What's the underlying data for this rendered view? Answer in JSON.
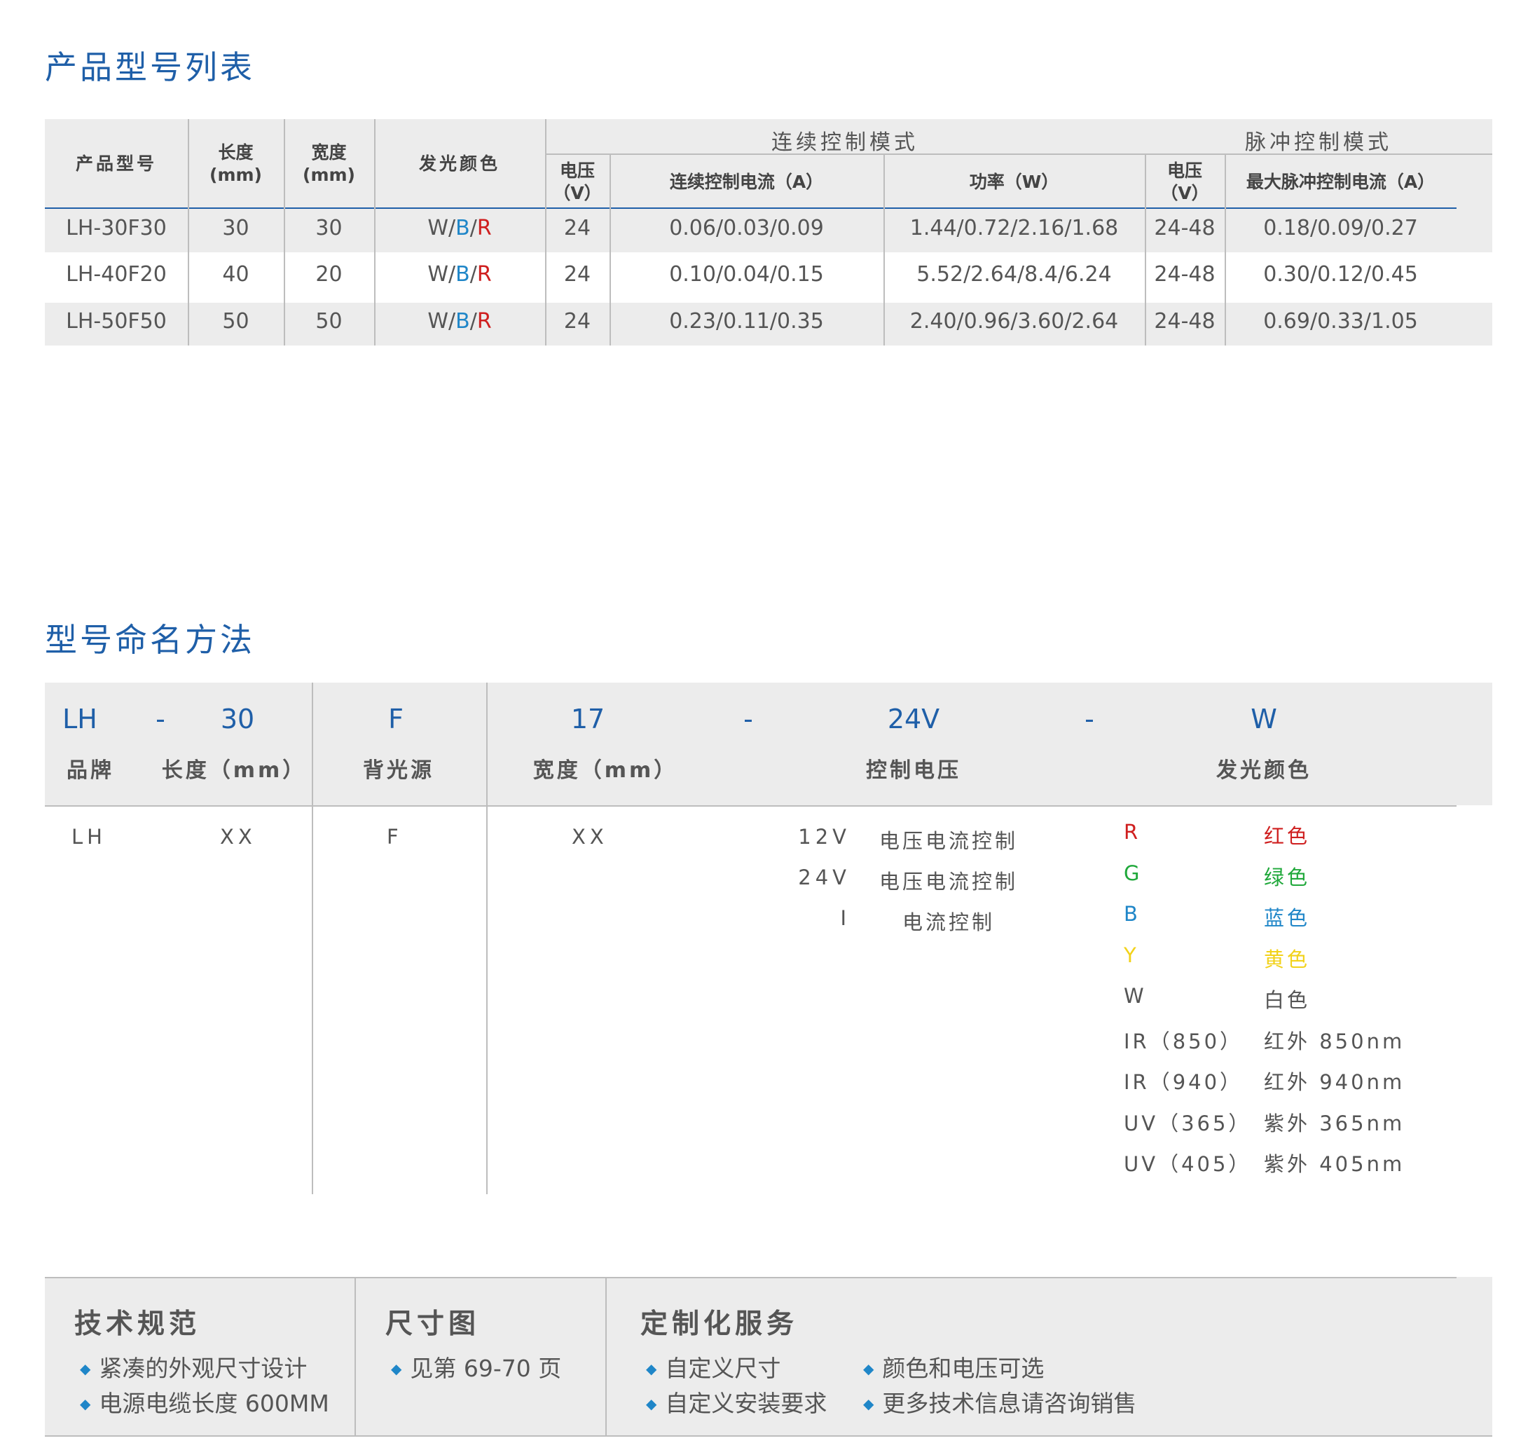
{
  "sections": {
    "model_list_title": "产品型号列表",
    "naming_title": "型号命名方法"
  },
  "table": {
    "headers": {
      "model": "产品型号",
      "length": "长度",
      "length_unit": "(mm)",
      "width": "宽度",
      "width_unit": "(mm)",
      "color": "发光颜色",
      "continuous_mode": "连续控制模式",
      "pulse_mode": "脉冲控制模式",
      "voltage": "电压",
      "voltage_unit": "（V）",
      "continuous_current": "连续控制电流（A）",
      "power": "功率（W）",
      "pulse_voltage": "电压",
      "pulse_voltage_unit": "（V）",
      "max_pulse_current": "最大脉冲控制电流（A）"
    },
    "rows": [
      {
        "model": "LH-30F30",
        "length": "30",
        "width": "30",
        "color_w": "W",
        "sep1": "/",
        "color_b": "B",
        "sep2": "/",
        "color_r": "R",
        "voltage": "24",
        "current": "0.06/0.03/0.09",
        "power": "1.44/0.72/2.16/1.68",
        "pulse_voltage": "24-48",
        "pulse_current": "0.18/0.09/0.27"
      },
      {
        "model": "LH-40F20",
        "length": "40",
        "width": "20",
        "color_w": "W",
        "sep1": "/",
        "color_b": "B",
        "sep2": "/",
        "color_r": "R",
        "voltage": "24",
        "current": "0.10/0.04/0.15",
        "power": "5.52/2.64/8.4/6.24",
        "pulse_voltage": "24-48",
        "pulse_current": "0.30/0.12/0.45"
      },
      {
        "model": "LH-50F50",
        "length": "50",
        "width": "50",
        "color_w": "W",
        "sep1": "/",
        "color_b": "B",
        "sep2": "/",
        "color_r": "R",
        "voltage": "24",
        "current": "0.23/0.11/0.35",
        "power": "2.40/0.96/3.60/2.64",
        "pulse_voltage": "24-48",
        "pulse_current": "0.69/0.33/1.05"
      }
    ]
  },
  "naming": {
    "codes": {
      "brand": "LH",
      "dash1": "-",
      "length": "30",
      "backlight": "F",
      "width": "17",
      "dash2": "-",
      "voltage": "24V",
      "dash3": "-",
      "color": "W"
    },
    "labels": {
      "brand": "品牌",
      "length": "长度（mm）",
      "backlight": "背光源",
      "width": "宽度（mm）",
      "voltage": "控制电压",
      "color": "发光颜色"
    },
    "values": {
      "brand": "LH",
      "length": "XX",
      "backlight": "F",
      "width": "XX"
    },
    "voltage_options": [
      {
        "code": "12V",
        "desc": "电压电流控制"
      },
      {
        "code": "24V",
        "desc": "电压电流控制"
      },
      {
        "code": "I",
        "desc": "电流控制"
      }
    ],
    "color_options": [
      {
        "code": "R",
        "desc": "红色",
        "color": "#cf1f1f"
      },
      {
        "code": "G",
        "desc": "绿色",
        "color": "#1fa83a"
      },
      {
        "code": "B",
        "desc": "蓝色",
        "color": "#1f86c8"
      },
      {
        "code": "Y",
        "desc": "黄色",
        "color": "#f2d21a"
      },
      {
        "code": "W",
        "desc": "白色",
        "color": "#555555"
      },
      {
        "code": "IR（850）",
        "desc": "红外 850nm",
        "color": "#555555"
      },
      {
        "code": "IR（940）",
        "desc": "红外 940nm",
        "color": "#555555"
      },
      {
        "code": "UV（365）",
        "desc": "紫外 365nm",
        "color": "#555555"
      },
      {
        "code": "UV（405）",
        "desc": "紫外 405nm",
        "color": "#555555"
      }
    ]
  },
  "bottom": {
    "spec_title": "技术规范",
    "spec_items": [
      "紧凑的外观尺寸设计",
      "电源电缆长度 600MM"
    ],
    "dim_title": "尺寸图",
    "dim_items": [
      "见第 69-70 页"
    ],
    "custom_title": "定制化服务",
    "custom_items": [
      "自定义尺寸",
      "颜色和电压可选",
      "自定义安装要求",
      "更多技术信息请咨询销售"
    ]
  },
  "colors": {
    "accent": "#1f5fa8",
    "header_bg": "#ececec",
    "blue": "#1f86c8",
    "red": "#cf1f1f"
  }
}
